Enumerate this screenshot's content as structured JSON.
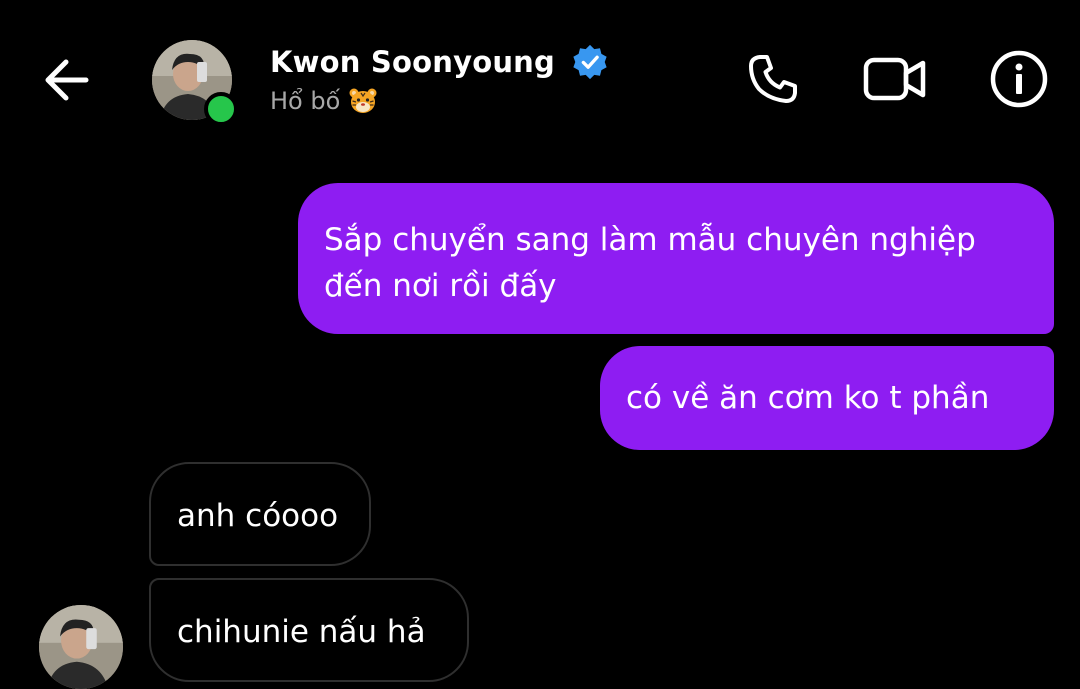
{
  "header": {
    "contact_name": "Kwon Soonyoung",
    "verified": true,
    "status_text": "Hổ bố",
    "status_emoji": "tiger-face",
    "online": true,
    "icons": [
      "arrow-left-icon",
      "phone-icon",
      "video-camera-icon",
      "info-icon"
    ]
  },
  "messages": [
    {
      "direction": "outgoing",
      "text": "Sắp chuyển sang làm mẫu chuyên nghiệp đến nơi rồi đấy"
    },
    {
      "direction": "outgoing",
      "text": "có về ăn cơm ko t phần"
    },
    {
      "direction": "incoming",
      "text": "anh cóooo"
    },
    {
      "direction": "incoming",
      "text": "chihunie nấu hả"
    }
  ],
  "colors": {
    "background": "#000000",
    "outgoing_bubble": "#8e1df2",
    "incoming_border": "#2f2f2f",
    "online_dot": "#26c64b",
    "verified_badge": "#3897f0",
    "status_text": "#a8a8a8"
  }
}
